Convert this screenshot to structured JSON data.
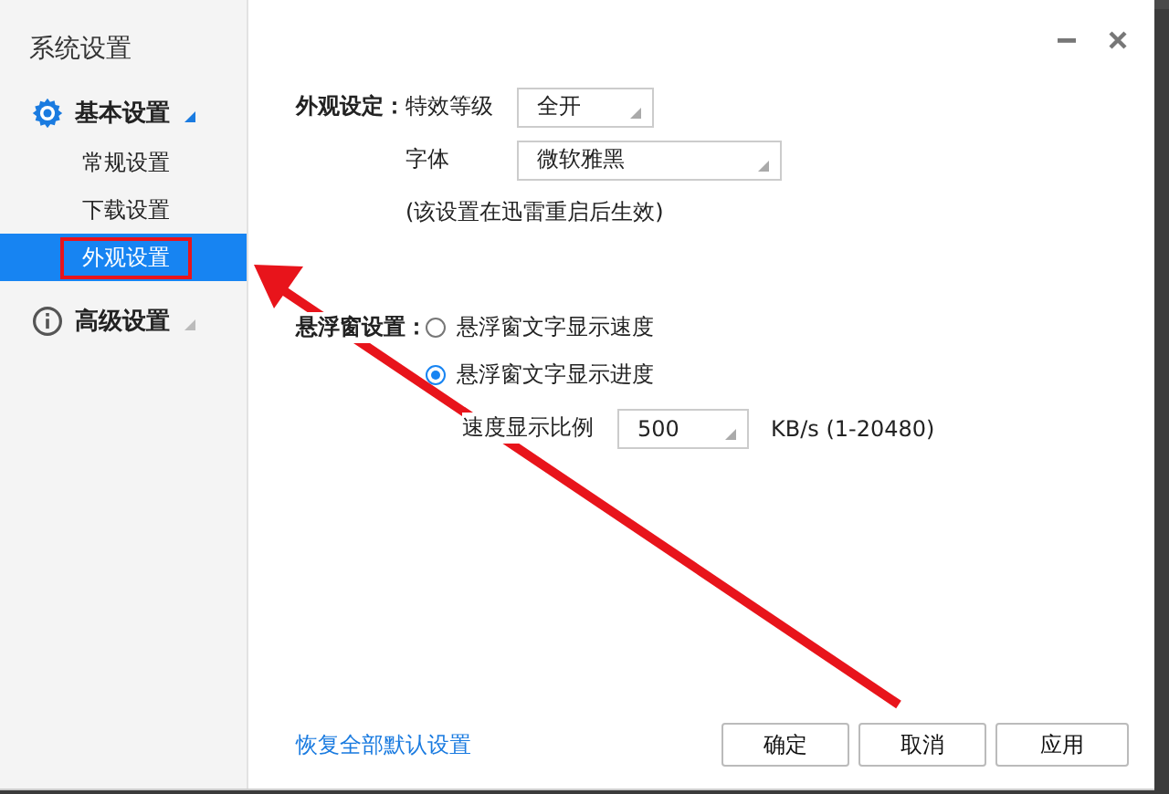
{
  "window": {
    "title": "系统设置"
  },
  "sidebar": {
    "groups": [
      {
        "label": "基本设置",
        "items": [
          {
            "label": "常规设置",
            "selected": false
          },
          {
            "label": "下载设置",
            "selected": false
          },
          {
            "label": "外观设置",
            "selected": true
          }
        ]
      },
      {
        "label": "高级设置"
      }
    ]
  },
  "appearance": {
    "section_label": "外观设定：",
    "effect_label": "特效等级",
    "effect_value": "全开",
    "font_label": "字体",
    "font_value": "微软雅黑",
    "note": "(该设置在迅雷重启后生效)"
  },
  "floating_window": {
    "section_label": "悬浮窗设置：",
    "options": [
      {
        "label": "悬浮窗文字显示速度",
        "selected": false
      },
      {
        "label": "悬浮窗文字显示进度",
        "selected": true
      }
    ],
    "scale_label": "速度显示比例",
    "scale_value": "500",
    "scale_unit": "KB/s (1-20480)"
  },
  "footer": {
    "reset_link": "恢复全部默认设置",
    "buttons": [
      "确定",
      "取消",
      "应用"
    ]
  }
}
